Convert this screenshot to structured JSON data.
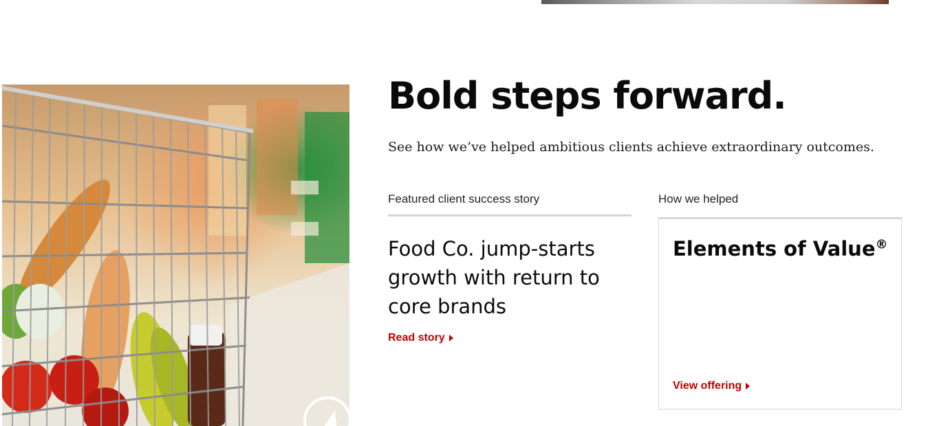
{
  "hero": {
    "headline": "Bold steps forward.",
    "subheadline": "See how we’ve helped ambitious clients achieve extraordinary outcomes."
  },
  "featured": {
    "label": "Featured client success story",
    "title": "Food Co. jump-starts growth with return to core brands",
    "link_label": "Read story"
  },
  "helped": {
    "label": "How we helped",
    "offer_title": "Elements of Value",
    "offer_mark": "®",
    "link_label": "View offering"
  },
  "icons": {
    "link_caret": "caret-right-icon",
    "media_control": "play-icon"
  },
  "colors": {
    "accent_red": "#c00000",
    "divider": "#d6d6d6",
    "text": "#0a0a0a"
  }
}
